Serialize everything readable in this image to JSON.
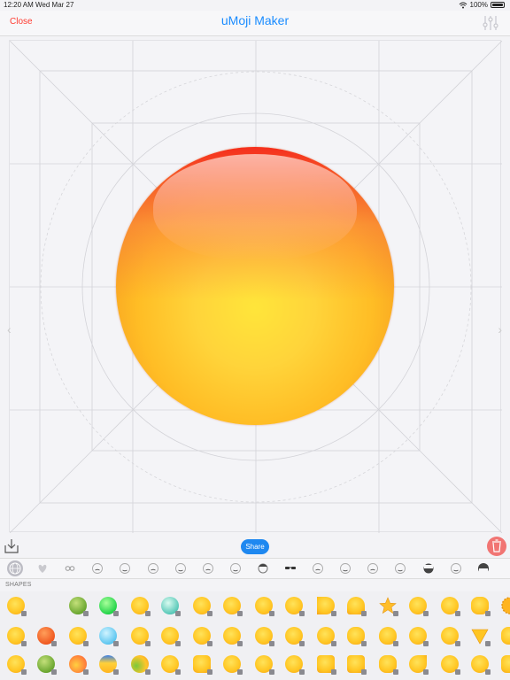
{
  "status_bar": {
    "time": "12:20 AM",
    "date": "Wed Mar 27",
    "battery": "100%"
  },
  "nav": {
    "close_label": "Close",
    "title": "uMoji Maker"
  },
  "toolbar": {
    "share_label": "Share"
  },
  "palette": {
    "section_label": "SHAPES"
  },
  "colors": {
    "accent": "#1e88f0",
    "title_blue": "#1a8cff",
    "close_red": "#ff3b30",
    "trash_red": "#f17573"
  },
  "categories": [
    {
      "icon": "globe-icon"
    },
    {
      "icon": "heart-icon"
    },
    {
      "icon": "eyes-icon"
    },
    {
      "icon": "closed-eyes-icon"
    },
    {
      "icon": "eyebrows-icon"
    },
    {
      "icon": "mouth-icon"
    },
    {
      "icon": "frown-mouth-icon"
    },
    {
      "icon": "nose-icon"
    },
    {
      "icon": "headphones-icon"
    },
    {
      "icon": "hair-icon"
    },
    {
      "icon": "sunglasses-icon"
    },
    {
      "icon": "mask-icon"
    },
    {
      "icon": "face-icon"
    },
    {
      "icon": "accessory-icon"
    },
    {
      "icon": "brow-icon"
    },
    {
      "icon": "beard-icon"
    },
    {
      "icon": "mustache-icon"
    },
    {
      "icon": "wig-icon"
    }
  ],
  "shapes": [
    [
      "smiley-shape",
      "empty",
      "green-ball",
      "bright-green-ball",
      "yellow-oval",
      "teal-ball",
      "yellow-blob",
      "yellow-blob",
      "crown-face",
      "yellow-oval",
      "half-face",
      "arch-shape",
      "star-shape",
      "tilted-oval",
      "bean-shape",
      "wide-oval",
      "sun-shape"
    ],
    [
      "tilted-face",
      "orange-ball",
      "halo-face",
      "teal-sphere",
      "cracked-face",
      "yellow-ball",
      "drip-face",
      "yellow-egg",
      "yellow-ball",
      "glow-ball",
      "split-ball",
      "tall-oval",
      "tall-egg",
      "heart-drop",
      "shield-shape",
      "triangle-shape",
      "wide-oval"
    ],
    [
      "yellow-ball",
      "green-ball",
      "red-ball",
      "blue-top-ball",
      "green-cheek-ball",
      "yellow-ball",
      "rounded-square",
      "fish-shape",
      "yellow-ball",
      "yellow-ball",
      "square-shape",
      "square-shape",
      "pill-shape",
      "drop-shape",
      "flower-shape",
      "cloud-shape",
      "round-square"
    ]
  ]
}
